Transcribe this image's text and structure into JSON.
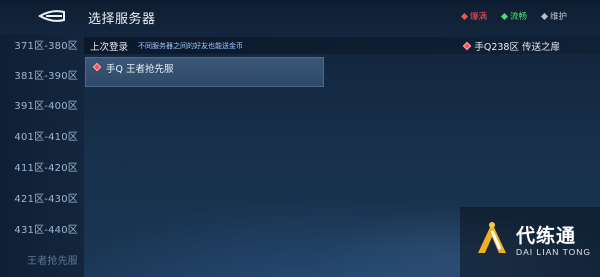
{
  "header": {
    "title": "选择服务器",
    "back_icon": "back-arrow-icon",
    "legend": [
      {
        "label": "爆满",
        "color": "#ff4d4d"
      },
      {
        "label": "流畅",
        "color": "#47e06a"
      },
      {
        "label": "维护",
        "color": "#b8c2ce"
      }
    ]
  },
  "sidebar": {
    "items": [
      {
        "label": "371区-380区"
      },
      {
        "label": "381区-390区"
      },
      {
        "label": "391区-400区"
      },
      {
        "label": "401区-410区"
      },
      {
        "label": "411区-420区"
      },
      {
        "label": "421区-430区"
      },
      {
        "label": "431区-440区"
      },
      {
        "label": "王者抢先服"
      }
    ]
  },
  "last_login": {
    "label": "上次登录",
    "note": "不同服务器之间的好友也能送金币",
    "server": "手Q238区 传送之扉",
    "status_color": "#ff4d4d"
  },
  "server_list": [
    {
      "name": "手Q 王者抢先服",
      "status_color": "#ff4d4d"
    }
  ],
  "watermark": {
    "title": "代练通",
    "subtitle": "DAI LIAN TONG"
  }
}
